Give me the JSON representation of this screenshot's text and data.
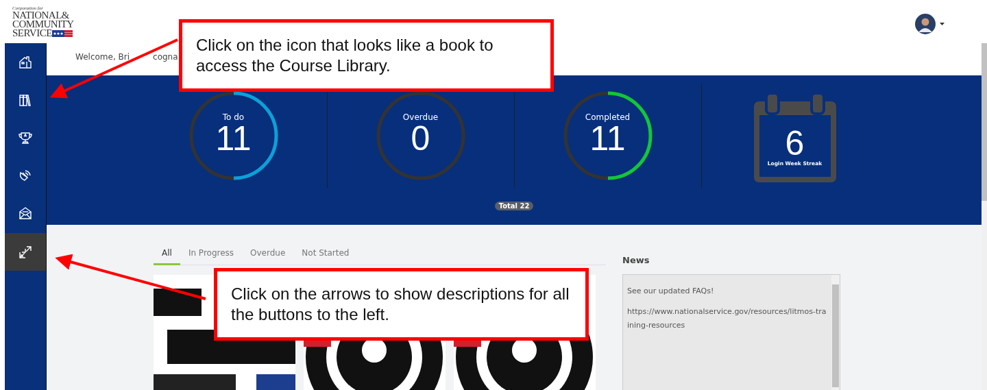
{
  "logo": {
    "tagline": "Corporation for",
    "lines": [
      "NATIONAL&",
      "COMMUNITY",
      "SERVICE"
    ]
  },
  "header": {
    "welcome": [
      "Welcome, Bri",
      "cogna"
    ]
  },
  "stats": [
    {
      "kind": "ring",
      "label": "To do",
      "value": "11",
      "level": 0.5,
      "color": "#0aa0dc"
    },
    {
      "kind": "ring",
      "label": "Overdue",
      "value": "0"
    },
    {
      "kind": "ring",
      "label": "Completed",
      "value": "11",
      "level": 0.5,
      "color": "#12c63c"
    },
    {
      "kind": "calendar",
      "label": "Login Week Streak",
      "value": "6"
    }
  ],
  "total_badge": "Total 22",
  "tabs": [
    {
      "label": "All",
      "selected": true
    },
    {
      "label": "In Progress",
      "selected": false
    },
    {
      "label": "Overdue",
      "selected": false
    },
    {
      "label": "Not Started",
      "selected": false
    }
  ],
  "news": {
    "title": "News",
    "items": [
      "See our updated FAQs!",
      "https://www.nationalservice.gov/resources/litmos-training-resources"
    ]
  },
  "callouts": [
    {
      "text": "Click on the icon that looks like a book to access the Course Library."
    },
    {
      "text": "Click on the arrows to show descriptions for all the buttons to the left."
    }
  ]
}
